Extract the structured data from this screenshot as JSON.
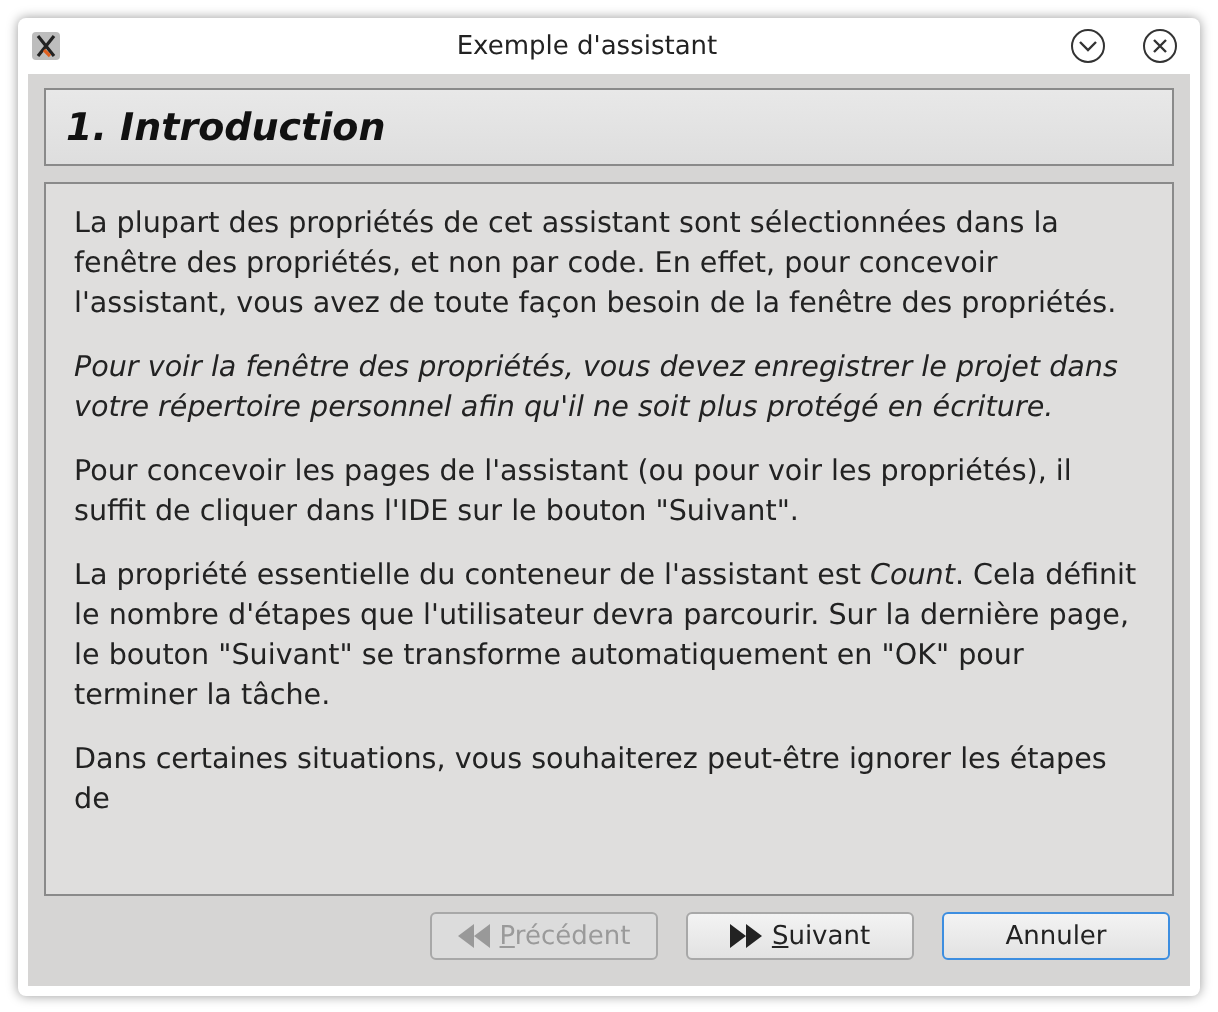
{
  "window": {
    "title": "Exemple d'assistant"
  },
  "page_title": "1. Introduction",
  "paragraphs": [
    {
      "text": "La plupart des propriétés de cet assistant sont sélectionnées dans la fenêtre des propriétés, et non par code. En effet, pour concevoir l'assistant, vous avez de toute façon besoin de la fenêtre des propriétés.",
      "italic": false
    },
    {
      "text": "Pour voir la fenêtre des propriétés, vous devez enregistrer le projet dans votre répertoire personnel afin qu'il ne soit plus protégé en écriture.",
      "italic": true
    },
    {
      "text": "Pour concevoir les pages de l'assistant (ou pour voir les propriétés), il suffit de cliquer dans l'IDE sur le bouton \"Suivant\".",
      "italic": false
    },
    {
      "text": "La propriété essentielle du conteneur de l'assistant est *Count*. Cela définit le nombre d'étapes que l'utilisateur devra parcourir. Sur la dernière page, le bouton \"Suivant\" se transforme automatiquement en \"OK\" pour terminer la tâche.",
      "italic": false
    },
    {
      "text": "Dans certaines situations, vous souhaiterez peut-être ignorer les étapes de",
      "italic": false
    }
  ],
  "buttons": [
    {
      "label": "Précédent",
      "kind": "previous",
      "disabled": true,
      "default": false,
      "mnemonic_first": true
    },
    {
      "label": "Suivant",
      "kind": "next",
      "disabled": false,
      "default": false,
      "mnemonic_first": true
    },
    {
      "label": "Annuler",
      "kind": "plain",
      "disabled": false,
      "default": true,
      "mnemonic_first": false
    }
  ]
}
